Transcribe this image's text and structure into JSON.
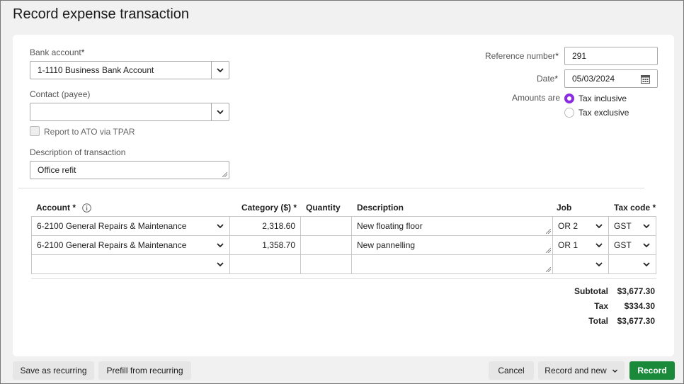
{
  "title": "Record expense transaction",
  "form": {
    "bank_account_label": "Bank account",
    "bank_account_value": "1-1110  Business Bank Account",
    "contact_label": "Contact (payee)",
    "contact_value": "",
    "report_ato_label": "Report to ATO via TPAR",
    "description_label": "Description of transaction",
    "description_value": "Office refit",
    "reference_label": "Reference number",
    "reference_value": "291",
    "date_label": "Date",
    "date_value": "05/03/2024",
    "amounts_label": "Amounts are",
    "tax_inclusive": "Tax inclusive",
    "tax_exclusive": "Tax exclusive",
    "amounts_selected": "Tax inclusive",
    "required_mark": "*"
  },
  "table": {
    "headers": {
      "account": "Account *",
      "category": "Category ($) *",
      "quantity": "Quantity",
      "description": "Description",
      "job": "Job",
      "taxcode": "Tax code *"
    },
    "rows": [
      {
        "account": "6-2100  General Repairs & Maintenance",
        "amount": "2,318.60",
        "quantity": "",
        "description": "New floating floor",
        "job": "OR 2",
        "taxcode": "GST"
      },
      {
        "account": "6-2100  General Repairs & Maintenance",
        "amount": "1,358.70",
        "quantity": "",
        "description": "New pannelling",
        "job": "OR 1",
        "taxcode": "GST"
      },
      {
        "account": "",
        "amount": "",
        "quantity": "",
        "description": "",
        "job": "",
        "taxcode": ""
      }
    ]
  },
  "totals": {
    "subtotal_label": "Subtotal",
    "subtotal_value": "$3,677.30",
    "tax_label": "Tax",
    "tax_value": "$334.30",
    "total_label": "Total",
    "total_value": "$3,677.30"
  },
  "buttons": {
    "save_recurring": "Save as recurring",
    "prefill_recurring": "Prefill from recurring",
    "cancel": "Cancel",
    "record_and_new": "Record and new",
    "record": "Record"
  },
  "colors": {
    "accent": "#8a2be2",
    "primary": "#1a8a3a"
  }
}
